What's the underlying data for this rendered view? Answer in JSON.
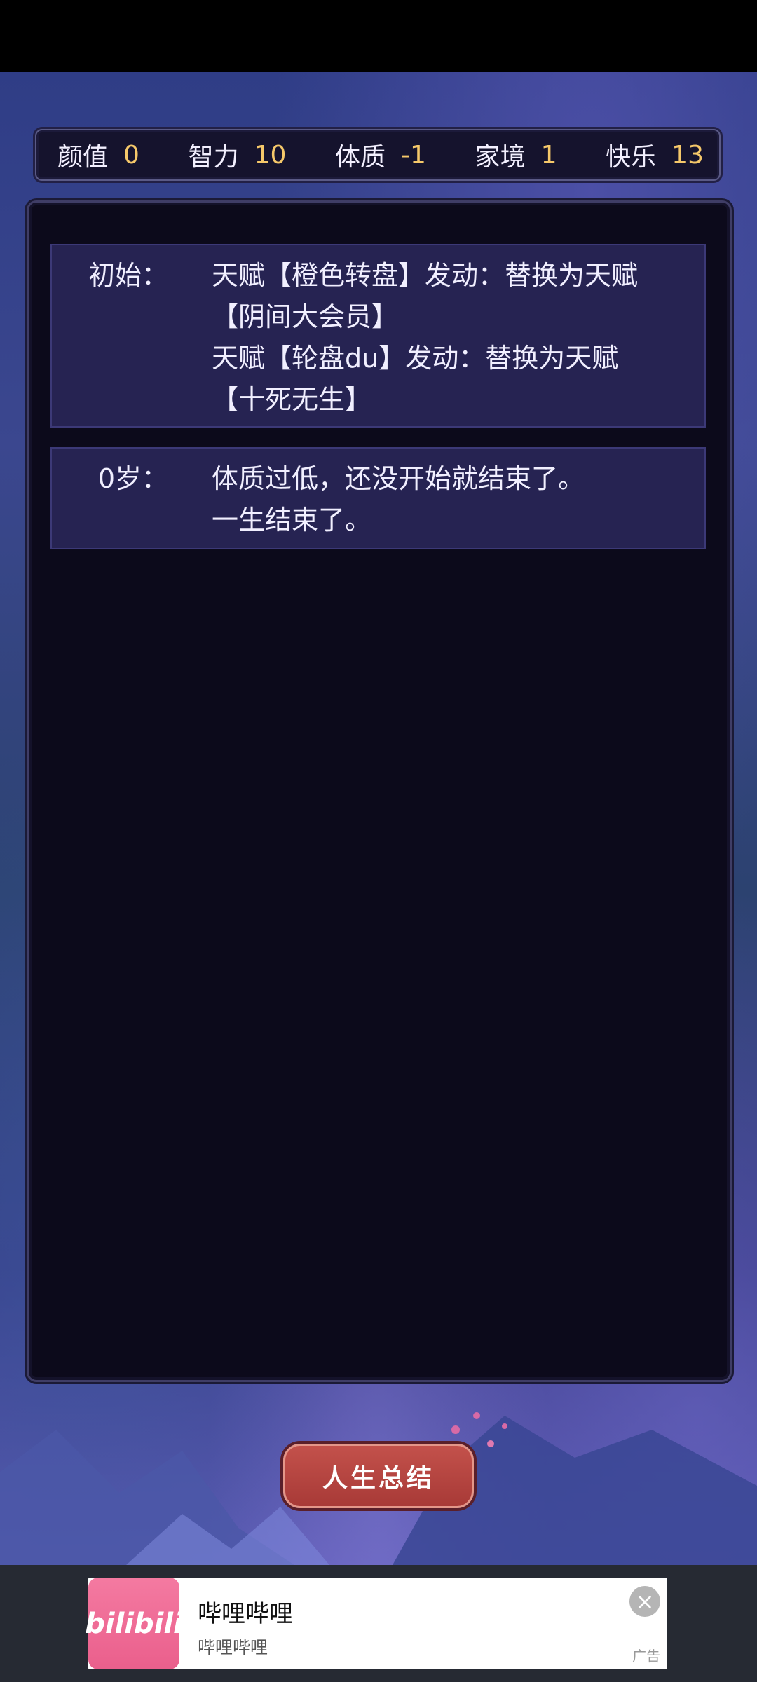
{
  "stats": [
    {
      "label": "颜值",
      "value": "0"
    },
    {
      "label": "智力",
      "value": "10"
    },
    {
      "label": "体质",
      "value": "-1"
    },
    {
      "label": "家境",
      "value": "1"
    },
    {
      "label": "快乐",
      "value": "13"
    }
  ],
  "log": [
    {
      "age": "初始：",
      "lines": [
        "天赋【橙色转盘】发动：替换为天赋",
        "【阴间大会员】",
        "天赋【轮盘du】发动：替换为天赋",
        "【十死无生】"
      ]
    },
    {
      "age": "0岁：",
      "lines": [
        "体质过低，还没开始就结束了。",
        "一生结束了。"
      ]
    }
  ],
  "summary_button": "人生总结",
  "ad": {
    "logo_text": "bilibili",
    "title": "哔哩哔哩",
    "subtitle": "哔哩哔哩",
    "close_icon": "×",
    "tag": "广告"
  },
  "colors": {
    "stat_value": "#f5c86a",
    "panel_bg": "#0c0a1b",
    "entry_bg": "#262352",
    "button_bg": "#b5433f"
  }
}
